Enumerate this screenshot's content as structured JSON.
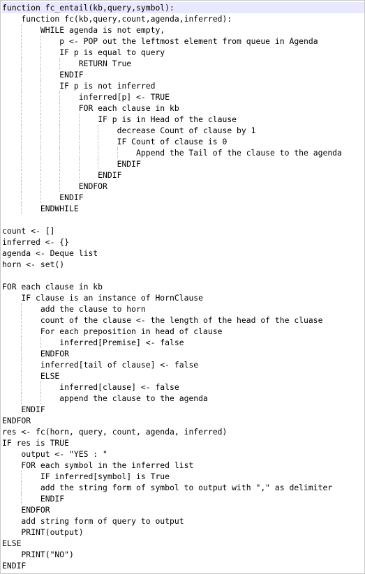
{
  "editor": {
    "lines": [
      "function fc_entail(kb,query,symbol):",
      "    function fc(kb,query,count,agenda,inferred):",
      "        WHILE agenda is not empty,",
      "            p <- POP out the leftmost element from queue in Agenda",
      "            IF p is equal to query",
      "                RETURN True",
      "            ENDIF",
      "            IF p is not inferred",
      "                inferred[p] <- TRUE",
      "                FOR each clause in kb",
      "                    IF p is in Head of the clause",
      "                        decrease Count of clause by 1",
      "                        IF Count of clause is 0",
      "                            Append the Tail of the clause to the agenda",
      "                        ENDIF",
      "                    ENDIF",
      "                ENDFOR",
      "            ENDIF",
      "        ENDWHILE",
      "",
      "count <- []",
      "inferred <- {}",
      "agenda <- Deque list",
      "horn <- set()",
      "",
      "FOR each clause in kb",
      "    IF clause is an instance of HornClause",
      "        add the clause to horn",
      "        count of the clause <- the length of the head of the cluase",
      "        For each preposition in head of clause",
      "            inferred[Premise] <- false",
      "        ENDFOR",
      "        inferred[tail of clause] <- false",
      "        ELSE",
      "            inferred[clause] <- false",
      "            append the clause to the agenda",
      "    ENDIF",
      "ENDFOR",
      "res <- fc(horn, query, count, agenda, inferred)",
      "IF res is TRUE",
      "    output <- \"YES : \"",
      "    FOR each symbol in the inferred list",
      "        IF inferred[symbol] is True",
      "        add the string form of symbol to output with \",\" as delimiter",
      "        ENDIF",
      "    ENDFOR",
      "    add string form of query to output",
      "    PRINT(output)",
      "ELSE",
      "    PRINT(\"NO\")",
      "ENDIF"
    ]
  }
}
